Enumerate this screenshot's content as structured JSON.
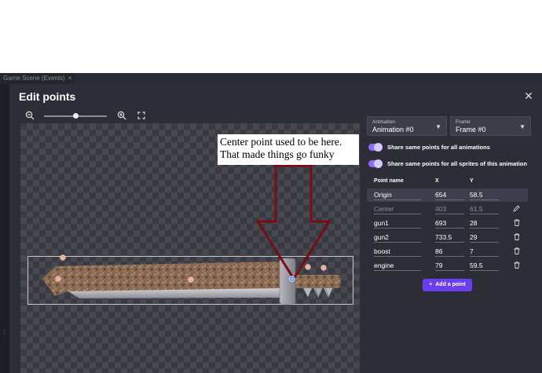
{
  "background": {
    "tab_label": "Game Scene (Events)",
    "tab_close": "×",
    "side_mark": "⋮⋮"
  },
  "dialog": {
    "title": "Edit points",
    "close_glyph": "✕"
  },
  "zoom": {
    "level": 0.5
  },
  "annotation": {
    "line1": "Center point used to be here.",
    "line2": "That made things go funky"
  },
  "animation_select": {
    "label": "Animation",
    "value": "Animation #0"
  },
  "frame_select": {
    "label": "Frame",
    "value": "Frame #0"
  },
  "toggles": {
    "share_animations": "Share same points for all animations",
    "share_sprites": "Share same points for all sprites of this animation"
  },
  "points_table": {
    "headers": {
      "name": "Point name",
      "x": "X",
      "y": "Y"
    },
    "rows": [
      {
        "name": "Origin",
        "x": "654",
        "y": "58.5"
      },
      {
        "name": "Center",
        "x": "403",
        "y": "61.5"
      },
      {
        "name": "gun1",
        "x": "693",
        "y": "28"
      },
      {
        "name": "gun2",
        "x": "733.5",
        "y": "29"
      },
      {
        "name": "boost",
        "x": "86",
        "y": "7"
      },
      {
        "name": "engine",
        "x": "79",
        "y": "59.5"
      }
    ]
  },
  "add_point_label": "Add a point",
  "colors": {
    "dialog_bg": "#2d2d38",
    "accent": "#6a3ef0",
    "toggle": "#8c6cf0",
    "arrow": "#7a0a14"
  }
}
